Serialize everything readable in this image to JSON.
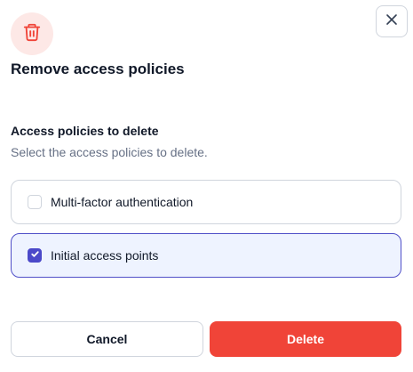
{
  "dialog": {
    "title": "Remove access policies",
    "header_icon": "trash-icon",
    "close_icon": "close-icon"
  },
  "section": {
    "label": "Access policies to delete",
    "help": "Select the access policies to delete."
  },
  "options": [
    {
      "label": "Multi-factor authentication",
      "checked": false
    },
    {
      "label": "Initial access points",
      "checked": true
    }
  ],
  "actions": {
    "cancel_label": "Cancel",
    "delete_label": "Delete"
  },
  "colors": {
    "danger": "#F04438",
    "danger_bg": "#FDE8E6",
    "accent": "#4B49C9",
    "selected_bg": "#EEF3FF"
  }
}
